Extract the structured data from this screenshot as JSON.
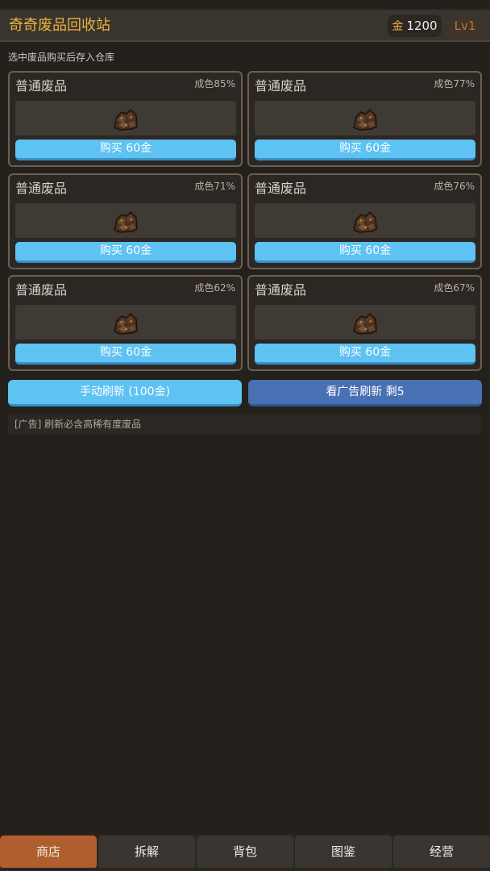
{
  "header": {
    "title": "奇奇废品回收站",
    "gold_label": "金",
    "gold_amount": "1200",
    "level": "Lv1"
  },
  "hint": "选中废品购买后存入仓库",
  "cards": [
    {
      "name": "普通废品",
      "quality": "成色85%",
      "buy_label": "购买 60金",
      "icon": "junk-pile-icon"
    },
    {
      "name": "普通废品",
      "quality": "成色77%",
      "buy_label": "购买 60金",
      "icon": "junk-pile-icon"
    },
    {
      "name": "普通废品",
      "quality": "成色71%",
      "buy_label": "购买 60金",
      "icon": "junk-pile-icon"
    },
    {
      "name": "普通废品",
      "quality": "成色76%",
      "buy_label": "购买 60金",
      "icon": "junk-pile-icon"
    },
    {
      "name": "普通废品",
      "quality": "成色62%",
      "buy_label": "购买 60金",
      "icon": "junk-pile-icon"
    },
    {
      "name": "普通废品",
      "quality": "成色67%",
      "buy_label": "购买 60金",
      "icon": "junk-pile-icon"
    }
  ],
  "actions": {
    "manual_refresh": "手动刷新 (100金)",
    "ad_refresh": "看广告刷新 剩5"
  },
  "ad_note": "[广告] 刷新必含高稀有度废品",
  "nav": {
    "tabs": [
      "商店",
      "拆解",
      "背包",
      "图鉴",
      "经营"
    ],
    "active": "商店"
  },
  "colors": {
    "accent_gold": "#e8b43c",
    "buy_button": "#5ec2f2",
    "ad_button": "#4a70b4",
    "active_tab": "#b05e2e"
  }
}
